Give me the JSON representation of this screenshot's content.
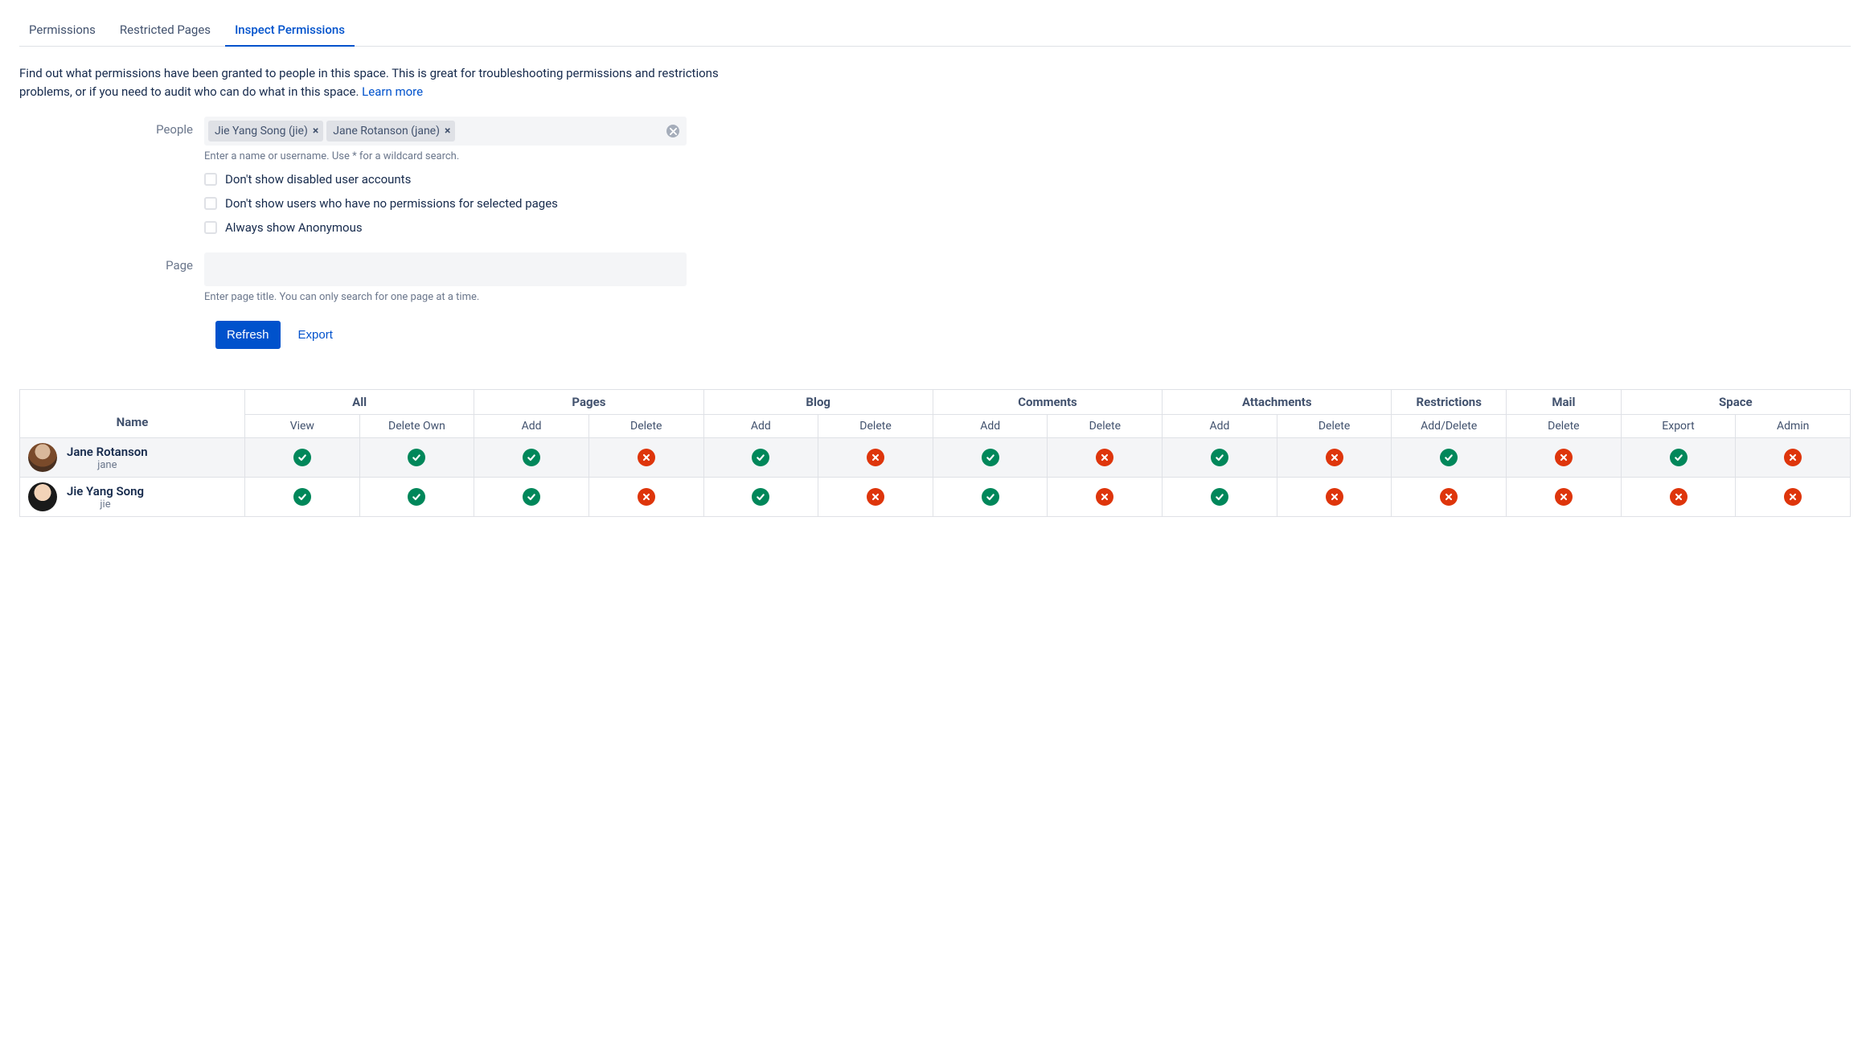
{
  "tabs": [
    "Permissions",
    "Restricted Pages",
    "Inspect Permissions"
  ],
  "active_tab_index": 2,
  "description": "Find out what permissions have been granted to people in this space. This is great for troubleshooting permissions and restrictions problems, or if you need to audit who can do what in this space. ",
  "learn_more": "Learn more",
  "form": {
    "people_label": "People",
    "people_chips": [
      "Jie Yang Song (jie)",
      "Jane Rotanson (jane)"
    ],
    "people_helper": "Enter a name or username. Use * for a wildcard search.",
    "checkboxes": [
      "Don't show disabled user accounts",
      "Don't show users who have no permissions for selected pages",
      "Always show Anonymous"
    ],
    "page_label": "Page",
    "page_helper": "Enter page title. You can only search for one page at a time."
  },
  "buttons": {
    "refresh": "Refresh",
    "export": "Export"
  },
  "table": {
    "name_header": "Name",
    "groups": [
      {
        "label": "All",
        "cols": [
          "View",
          "Delete Own"
        ]
      },
      {
        "label": "Pages",
        "cols": [
          "Add",
          "Delete"
        ]
      },
      {
        "label": "Blog",
        "cols": [
          "Add",
          "Delete"
        ]
      },
      {
        "label": "Comments",
        "cols": [
          "Add",
          "Delete"
        ]
      },
      {
        "label": "Attachments",
        "cols": [
          "Add",
          "Delete"
        ]
      },
      {
        "label": "Restrictions",
        "cols": [
          "Add/Delete"
        ]
      },
      {
        "label": "Mail",
        "cols": [
          "Delete"
        ]
      },
      {
        "label": "Space",
        "cols": [
          "Export",
          "Admin"
        ]
      }
    ],
    "rows": [
      {
        "name": "Jane Rotanson",
        "username": "jane",
        "avatar_class": "a1",
        "perms": [
          true,
          true,
          true,
          false,
          true,
          false,
          true,
          false,
          true,
          false,
          true,
          false,
          true,
          false
        ]
      },
      {
        "name": "Jie Yang Song",
        "username": "jie",
        "avatar_class": "a2",
        "perms": [
          true,
          true,
          true,
          false,
          true,
          false,
          true,
          false,
          true,
          false,
          false,
          false,
          false,
          false
        ]
      }
    ]
  }
}
